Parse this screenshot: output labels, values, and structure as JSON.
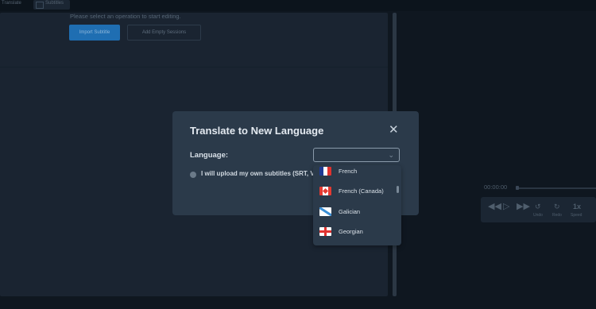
{
  "topbar": {
    "tabs": [
      "Translate",
      "Subtitles"
    ]
  },
  "editor": {
    "prompt": "Please select an operation to start editing.",
    "import_button": "Import Subtitle",
    "add_empty_button": "Add Empty Sessions"
  },
  "player": {
    "timecode": "00:00:00",
    "labels": [
      "Undo",
      "Redo",
      "Speed"
    ],
    "speed": "1x",
    "icons": [
      "rewind-icon",
      "play-icon",
      "fast-forward-icon",
      "undo-icon",
      "redo-icon"
    ]
  },
  "modal": {
    "title": "Translate to New Language",
    "close_glyph": "✕",
    "language_label": "Language:",
    "select_value": "",
    "upload_option": "I will upload my own subtitles (SRT, VTT)"
  },
  "dropdown": {
    "options": [
      {
        "label": "French",
        "flag": "france-flag-icon"
      },
      {
        "label": "French (Canada)",
        "flag": "canada-flag-icon"
      },
      {
        "label": "Galician",
        "flag": "galicia-flag-icon"
      },
      {
        "label": "Georgian",
        "flag": "georgia-flag-icon"
      }
    ]
  },
  "colors": {
    "accent": "#1f6eb2",
    "modal_bg": "#2b3a4a",
    "page_bg": "#0f1720"
  }
}
